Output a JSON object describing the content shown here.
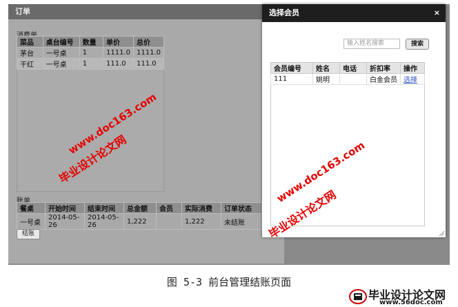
{
  "main_window": {
    "title": "订单",
    "consumption": {
      "caption": "消费单",
      "headers": [
        "菜品",
        "桌台编号",
        "数量",
        "单价",
        "总价"
      ],
      "rows": [
        [
          "茅台",
          "一号桌",
          "1",
          "1111.0",
          "1111.0"
        ],
        [
          "干红",
          "一号桌",
          "1",
          "111.0",
          "111.0"
        ]
      ]
    },
    "bill": {
      "caption": "账单",
      "headers": [
        "餐桌",
        "开始时间",
        "结束时间",
        "总金额",
        "会员",
        "实际消费",
        "订单状态"
      ],
      "rows": [
        [
          "一号桌",
          "2014-05-26",
          "2014-05-26",
          "1,222",
          "",
          "1,222",
          "未结账"
        ]
      ]
    },
    "checkout_button": "结账"
  },
  "dialog": {
    "title": "选择会员",
    "close": "×",
    "search_placeholder": "输入姓名搜索",
    "search_button": "搜索",
    "headers": [
      "会员编号",
      "姓名",
      "电话",
      "折扣率",
      "操作"
    ],
    "rows": [
      {
        "id": "111",
        "name": "姚明",
        "phone": "",
        "discount": "白金会员",
        "action": "选择"
      }
    ]
  },
  "watermarks": {
    "url": "www.doc163.com",
    "site": "毕业设计论文网"
  },
  "caption": "图 5-3 前台管理结账页面",
  "logo": {
    "name": "毕业设计论文网",
    "url": "www.56doc.com"
  },
  "colors": {
    "dialog_title_bg": "#1e1e1e",
    "watermark": "#e60000",
    "link": "#2a52be"
  }
}
